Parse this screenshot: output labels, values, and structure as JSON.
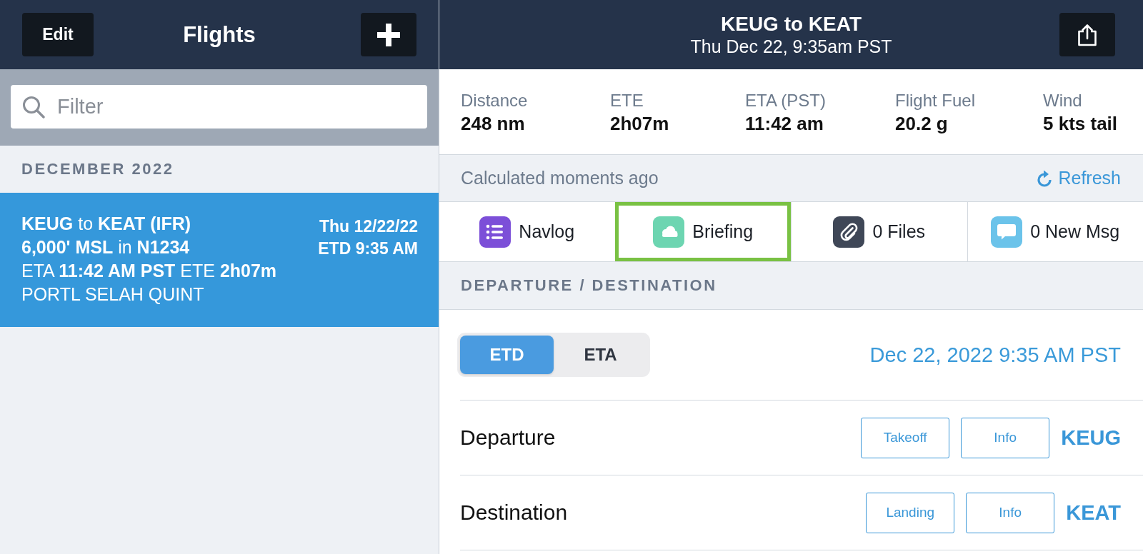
{
  "sidebar": {
    "edit_button": "Edit",
    "title": "Flights",
    "filter": {
      "placeholder": "Filter"
    },
    "sections": [
      {
        "title": "DECEMBER 2022",
        "flights": [
          {
            "selected": true,
            "route": "**KEUG** to **KEAT (IFR)**",
            "altitude": "**6,000' MSL** in **N1234**",
            "times": "ETA **11:42 AM PST** ETE **2h07m**",
            "waypoints": "PORTL SELAH QUINT",
            "date": "Thu 12/22/22",
            "departure_time": "ETD 9:35 AM"
          }
        ]
      }
    ]
  },
  "detail": {
    "title": "KEUG to KEAT",
    "subtitle": "Thu Dec 22, 9:35am PST",
    "stats": [
      {
        "label": "Distance",
        "value": "248 nm"
      },
      {
        "label": "ETE",
        "value": "2h07m"
      },
      {
        "label": "ETA (PST)",
        "value": "11:42 am"
      },
      {
        "label": "Flight Fuel",
        "value": "20.2 g"
      },
      {
        "label": "Wind",
        "value": "5 kts tail"
      }
    ],
    "status": "Calculated moments ago",
    "refresh_button": "Refresh",
    "tabs": [
      {
        "label": "Navlog",
        "kind": "list",
        "color": "#7c4fd8",
        "selected": false
      },
      {
        "label": "Briefing",
        "kind": "cloud",
        "color": "#6dd5b1",
        "selected": true
      },
      {
        "label": "0 Files",
        "kind": "paperclip",
        "color": "#3f4757",
        "selected": false
      },
      {
        "label": "0 New Msg",
        "kind": "chat",
        "color": "#6bc3ea",
        "selected": false
      }
    ],
    "section_title": "DEPARTURE / DESTINATION",
    "time_modes": [
      {
        "label": "ETD",
        "selected": true
      },
      {
        "label": "ETA",
        "selected": false
      }
    ],
    "time_value": "Dec 22, 2022 9:35 AM PST",
    "airports": [
      {
        "label": "Departure",
        "buttons": [
          "Takeoff",
          "Info"
        ],
        "code": "KEUG"
      },
      {
        "label": "Destination",
        "buttons": [
          "Landing",
          "Info"
        ],
        "code": "KEAT"
      }
    ]
  }
}
